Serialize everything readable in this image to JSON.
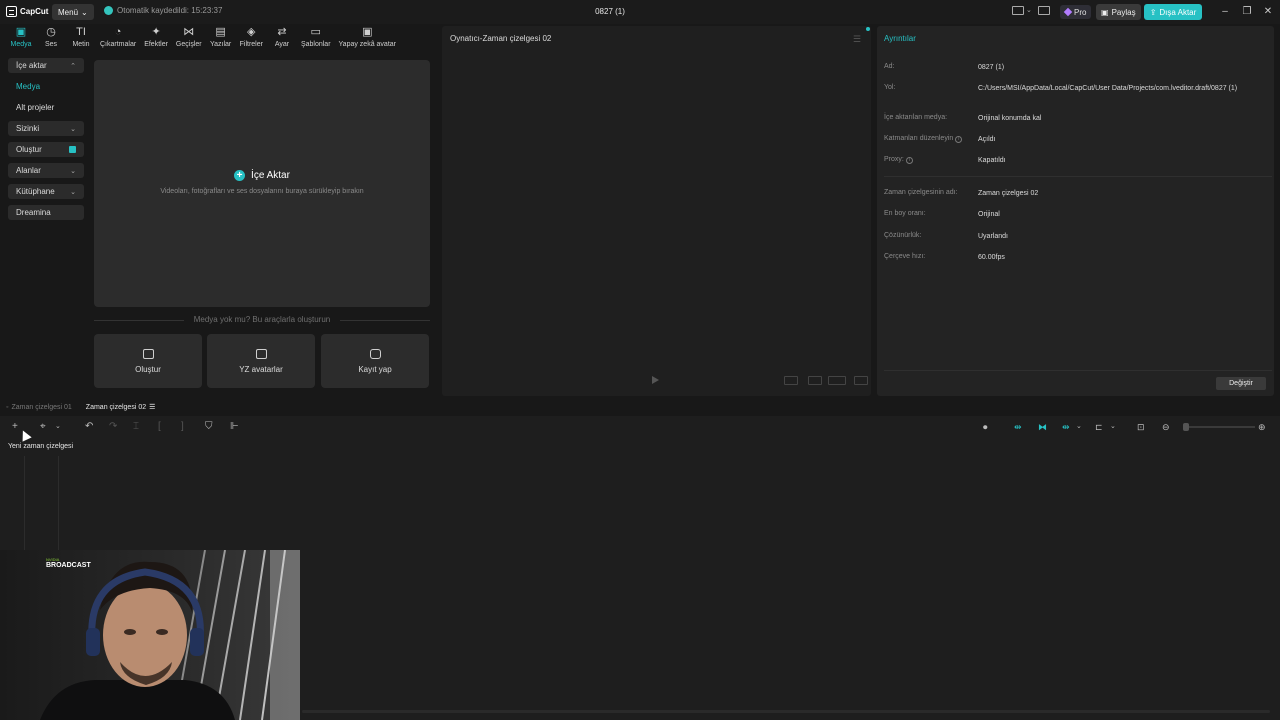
{
  "titlebar": {
    "app_name": "CapCut",
    "menu_label": "Menü",
    "autosave_text": "Otomatik kaydedildi: 15:23:37",
    "project_title": "0827 (1)",
    "pro_label": "Pro",
    "share_label": "Paylaş",
    "export_label": "Dışa Aktar"
  },
  "toolbar": {
    "tools": [
      {
        "label": "Medya",
        "icon": "media-icon",
        "glyph": "▣"
      },
      {
        "label": "Ses",
        "icon": "audio-icon",
        "glyph": "◷"
      },
      {
        "label": "Metin",
        "icon": "text-icon",
        "glyph": "TI"
      },
      {
        "label": "Çıkartmalar",
        "icon": "sticker-icon",
        "glyph": "◔"
      },
      {
        "label": "Efektler",
        "icon": "effects-icon",
        "glyph": "✦"
      },
      {
        "label": "Geçişler",
        "icon": "transitions-icon",
        "glyph": "⋈"
      },
      {
        "label": "Yazılar",
        "icon": "captions-icon",
        "glyph": "▤"
      },
      {
        "label": "Filtreler",
        "icon": "filters-icon",
        "glyph": "◈"
      },
      {
        "label": "Ayar",
        "icon": "adjust-icon",
        "glyph": "⇄"
      },
      {
        "label": "Şablonlar",
        "icon": "templates-icon",
        "glyph": "▭"
      },
      {
        "label": "Yapay zekâ avatar",
        "icon": "ai-avatar-icon",
        "glyph": "▣"
      }
    ]
  },
  "sidebar": {
    "items": [
      {
        "label": "İçe aktar",
        "chevron": "⌃"
      },
      {
        "label": "Medya"
      },
      {
        "label": "Alt projeler"
      },
      {
        "label": "Sizinki",
        "chevron": "⌄"
      },
      {
        "label": "Oluştur"
      },
      {
        "label": "Alanlar",
        "chevron": "⌄"
      },
      {
        "label": "Kütüphane",
        "chevron": "⌄"
      },
      {
        "label": "Dreamina"
      }
    ]
  },
  "media": {
    "import_label": "İçe Aktar",
    "import_hint": "Videoları, fotoğrafları ve ses dosyalarını buraya sürükleyip bırakın",
    "no_media_text": "Medya yok mu? Bu araçlarla oluşturun",
    "cards": [
      {
        "label": "Oluştur",
        "icon": "create-icon"
      },
      {
        "label": "YZ avatarlar",
        "icon": "ai-avatar-icon"
      },
      {
        "label": "Kayıt yap",
        "icon": "record-icon"
      }
    ]
  },
  "player": {
    "title": "Oynatıcı-Zaman çizelgesi 02"
  },
  "details": {
    "title": "Ayrıntılar",
    "rows": [
      {
        "key": "Ad:",
        "value": "0827 (1)"
      },
      {
        "key": "Yol:",
        "value": "C:/Users/MSI/AppData/Local/CapCut/User Data/Projects/com.lveditor.draft/0827 (1)"
      },
      {
        "key": "İçe aktarılan medya:",
        "value": "Orijinal konumda kal"
      },
      {
        "key": "Katmanları düzenleyin",
        "value": "Açıldı"
      },
      {
        "key": "Proxy:",
        "value": "Kapatıldı"
      },
      {
        "key": "Zaman çizelgesinin adı:",
        "value": "Zaman çizelgesi 02"
      },
      {
        "key": "En boy oranı:",
        "value": "Orijinal"
      },
      {
        "key": "Çözünürlük:",
        "value": "Uyarlandı"
      },
      {
        "key": "Çerçeve hızı:",
        "value": "60.00fps"
      }
    ],
    "change_label": "Değiştir"
  },
  "timeline": {
    "tabs": [
      {
        "label": "Zaman çizelgesi 01"
      },
      {
        "label": "Zaman çizelgesi 02"
      }
    ],
    "tooltip": "Yeni zaman çizelgesi"
  },
  "webcam": {
    "brand": "BROADCAST",
    "brand_top": "NVIDIA"
  },
  "colors": {
    "accent": "#27c1c4",
    "background": "#181818",
    "panel": "#2c2c2c"
  }
}
